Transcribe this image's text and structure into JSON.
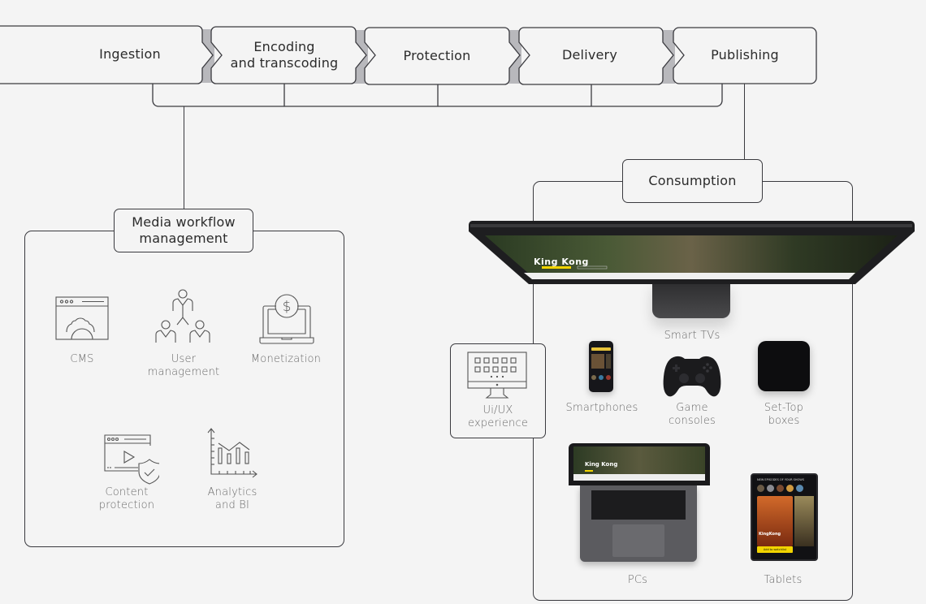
{
  "pipeline": {
    "stages": [
      {
        "label": "Ingestion"
      },
      {
        "label": "Encoding\nand transcoding"
      },
      {
        "label": "Protection"
      },
      {
        "label": "Delivery"
      },
      {
        "label": "Publishing"
      }
    ]
  },
  "workflow": {
    "title": "Media workflow\nmanagement",
    "items": [
      {
        "label": "CMS",
        "icon": "cms-window-gear-icon"
      },
      {
        "label": "User\nmanagement",
        "icon": "user-hierarchy-icon"
      },
      {
        "label": "Monetization",
        "icon": "laptop-dollar-icon"
      },
      {
        "label": "Content\nprotection",
        "icon": "video-shield-icon"
      },
      {
        "label": "Analytics\nand BI",
        "icon": "bar-chart-icon"
      }
    ]
  },
  "consumption": {
    "title": "Consumption",
    "devices": [
      {
        "label": "Smart TVs",
        "icon": "smart-tv-icon"
      },
      {
        "label": "Smartphones",
        "icon": "smartphone-icon"
      },
      {
        "label": "Game\nconsoles",
        "icon": "gamepad-icon"
      },
      {
        "label": "Set-Top\nboxes",
        "icon": "set-top-box-icon"
      },
      {
        "label": "PCs",
        "icon": "laptop-icon"
      },
      {
        "label": "Tablets",
        "icon": "tablet-icon"
      }
    ],
    "uiux": {
      "label": "Ui/UX\nexperience",
      "icon": "monitor-grid-icon"
    }
  },
  "screens": {
    "tv_title": "King Kong",
    "tablet_heading": "NEW EPISODES OF YOUR SHOWS",
    "tablet_title": "KingKong",
    "tablet_button": "Add to watchlist"
  }
}
